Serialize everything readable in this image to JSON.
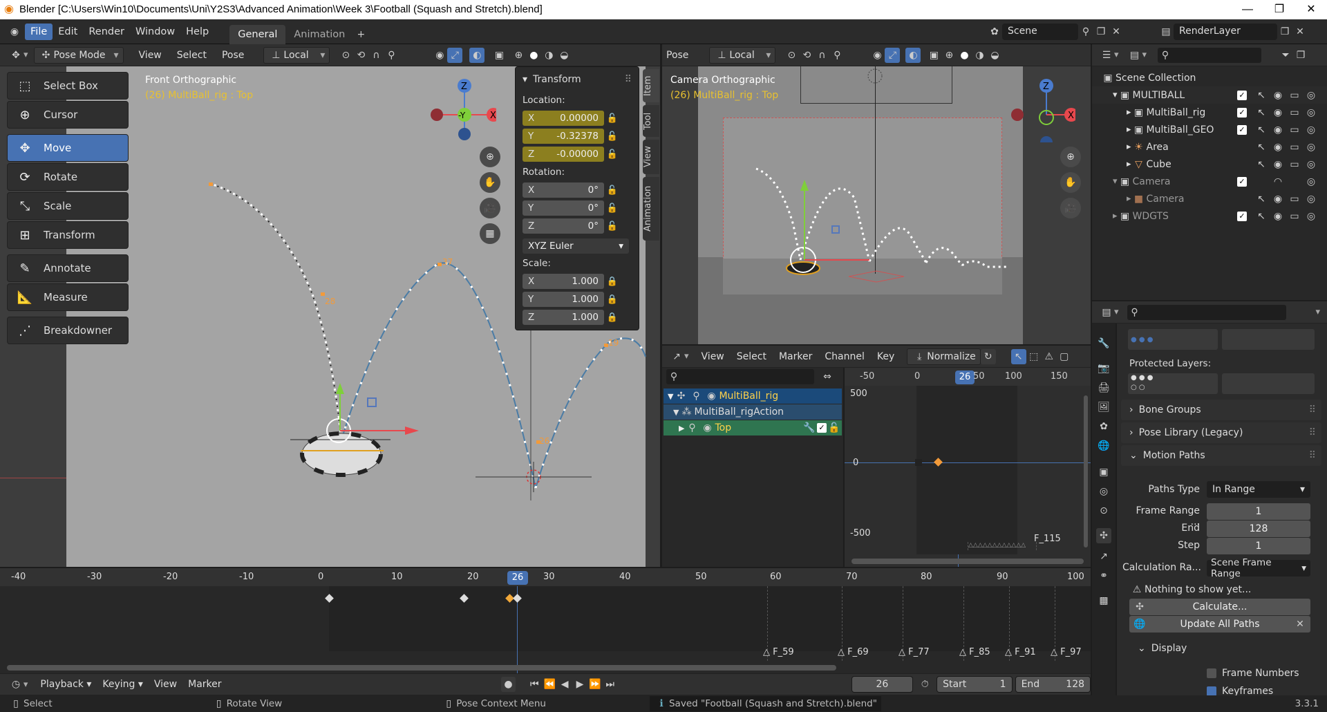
{
  "title": "Blender [C:\\Users\\Win10\\Documents\\Uni\\Y2S3\\Advanced Animation\\Week 3\\Football (Squash and Stretch).blend]",
  "menus": [
    "File",
    "Edit",
    "Render",
    "Window",
    "Help"
  ],
  "workspaces": [
    "General",
    "Animation"
  ],
  "scene": "Scene",
  "renderlayer": "RenderLayer",
  "vp_header": {
    "mode": "Pose Mode",
    "view": "View",
    "select": "Select",
    "pose": "Pose",
    "orient": "Local"
  },
  "tools": [
    "Select Box",
    "Cursor",
    "Move",
    "Rotate",
    "Scale",
    "Transform",
    "Annotate",
    "Measure",
    "Breakdowner"
  ],
  "vp1": {
    "view_name": "Front Orthographic",
    "sub": "(26) MultiBall_rig : Top"
  },
  "transform": {
    "title": "Transform",
    "location_label": "Location:",
    "loc": [
      {
        "a": "X",
        "v": "0.00000"
      },
      {
        "a": "Y",
        "v": "-0.32378"
      },
      {
        "a": "Z",
        "v": "-0.00000"
      }
    ],
    "rotation_label": "Rotation:",
    "rot": [
      {
        "a": "X",
        "v": "0°"
      },
      {
        "a": "Y",
        "v": "0°"
      },
      {
        "a": "Z",
        "v": "0°"
      }
    ],
    "euler": "XYZ Euler",
    "scale_label": "Scale:",
    "scl": [
      {
        "a": "X",
        "v": "1.000"
      },
      {
        "a": "Y",
        "v": "1.000"
      },
      {
        "a": "Z",
        "v": "1.000"
      }
    ]
  },
  "ntabs": [
    "Item",
    "Tool",
    "View",
    "Animation"
  ],
  "vp2": {
    "view_name": "Camera Orthographic",
    "sub": "(26) MultiBall_rig : Top",
    "pose": "Pose",
    "orient": "Local"
  },
  "path_labels_1": [
    "28",
    "37",
    "19",
    "26"
  ],
  "graph": {
    "menus": [
      "View",
      "Select",
      "Marker",
      "Channel",
      "Key"
    ],
    "normalize": "Normalize",
    "channels": [
      "MultiBall_rig",
      "MultiBall_rigAction",
      "Top"
    ],
    "ruler": [
      "-50",
      "0",
      "26",
      "50",
      "100",
      "150"
    ],
    "y500": "500",
    "y0": "0",
    "ym500": "-500",
    "marker": "F_115"
  },
  "timeline": {
    "ruler": [
      "-40",
      "-30",
      "-20",
      "-10",
      "0",
      "10",
      "20",
      "26",
      "30",
      "40",
      "50",
      "60",
      "70",
      "80",
      "90",
      "100"
    ],
    "markers": [
      "F_59",
      "F_69",
      "F_77",
      "F_85",
      "F_91",
      "F_97"
    ],
    "menus": [
      "Playback",
      "Keying",
      "View",
      "Marker"
    ],
    "frame": "26",
    "start_label": "Start",
    "start": "1",
    "end_label": "End",
    "end": "128"
  },
  "outliner": {
    "root": "Scene Collection",
    "items": [
      {
        "name": "MULTIBALL",
        "depth": 1
      },
      {
        "name": "MultiBall_rig",
        "depth": 2
      },
      {
        "name": "MultiBall_GEO",
        "depth": 2
      },
      {
        "name": "Area",
        "depth": 2
      },
      {
        "name": "Cube",
        "depth": 2
      },
      {
        "name": "Camera",
        "depth": 1
      },
      {
        "name": "Camera",
        "depth": 2
      },
      {
        "name": "WDGTS",
        "depth": 1
      }
    ]
  },
  "props": {
    "protected": "Protected Layers:",
    "bone_groups": "Bone Groups",
    "pose_library": "Pose Library (Legacy)",
    "motion_paths": "Motion Paths",
    "paths_type_label": "Paths Type",
    "paths_type": "In Range",
    "frame_range_label": "Frame Range ...",
    "frame_range": "1",
    "end_label": "End",
    "end": "128",
    "step_label": "Step",
    "step": "1",
    "calc_range_label": "Calculation Ra...",
    "calc_range": "Scene Frame Range",
    "nothing": "Nothing to show yet...",
    "calculate": "Calculate...",
    "update": "Update All Paths",
    "display": "Display",
    "frame_numbers": "Frame Numbers",
    "keyframes": "Keyframes"
  },
  "status": {
    "select": "Select",
    "rotate": "Rotate View",
    "pose_ctx": "Pose Context Menu",
    "saved": "Saved \"Football (Squash and Stretch).blend\"",
    "version": "3.3.1"
  }
}
